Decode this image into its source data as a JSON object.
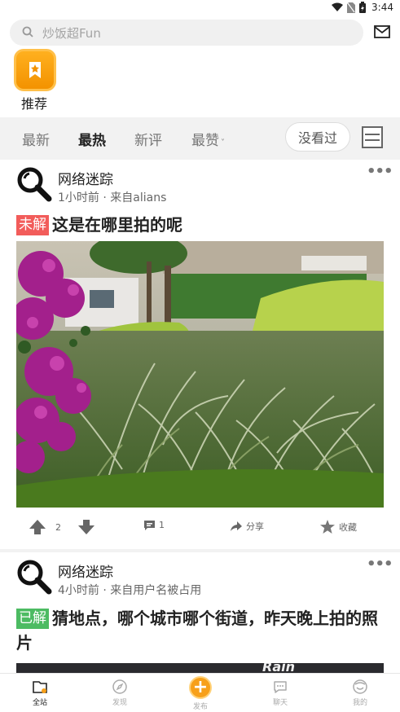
{
  "status_bar": {
    "time": "3:44"
  },
  "search": {
    "placeholder": "炒饭超Fun"
  },
  "categories": [
    {
      "label": "推荐"
    }
  ],
  "tabs": [
    {
      "label": "最新",
      "active": false
    },
    {
      "label": "最热",
      "active": true
    },
    {
      "label": "新评",
      "active": false
    },
    {
      "label": "最赞",
      "active": false
    }
  ],
  "tab_caret": "˅",
  "unread_button": "没看过",
  "posts": [
    {
      "author": "网络迷踪",
      "meta": "1小时前 · 来自alians",
      "badge": "未解",
      "title": "这是在哪里拍的呢",
      "image": "garden-photo",
      "upvotes": "2",
      "comments": "1",
      "share_label": "分享",
      "collect_label": "收藏"
    },
    {
      "author": "网络迷踪",
      "meta": "4小时前 · 来自用户名被占用",
      "badge": "已解",
      "title": "猜地点，哪个城市哪个街道，昨天晚上拍的照片",
      "image_partial_text": "Rain"
    }
  ],
  "bottom_nav": [
    {
      "label": "全站",
      "icon": "home-icon",
      "active": true
    },
    {
      "label": "发现",
      "icon": "compass-icon",
      "active": false
    },
    {
      "label": "发布",
      "icon": "plus-icon",
      "active": false
    },
    {
      "label": "聊天",
      "icon": "chat-icon",
      "active": false
    },
    {
      "label": "我的",
      "icon": "profile-icon",
      "active": false
    }
  ],
  "colors": {
    "accent": "#f7a01a",
    "unsolved_badge": "#f25c5a",
    "solved_badge": "#4cbb62"
  }
}
